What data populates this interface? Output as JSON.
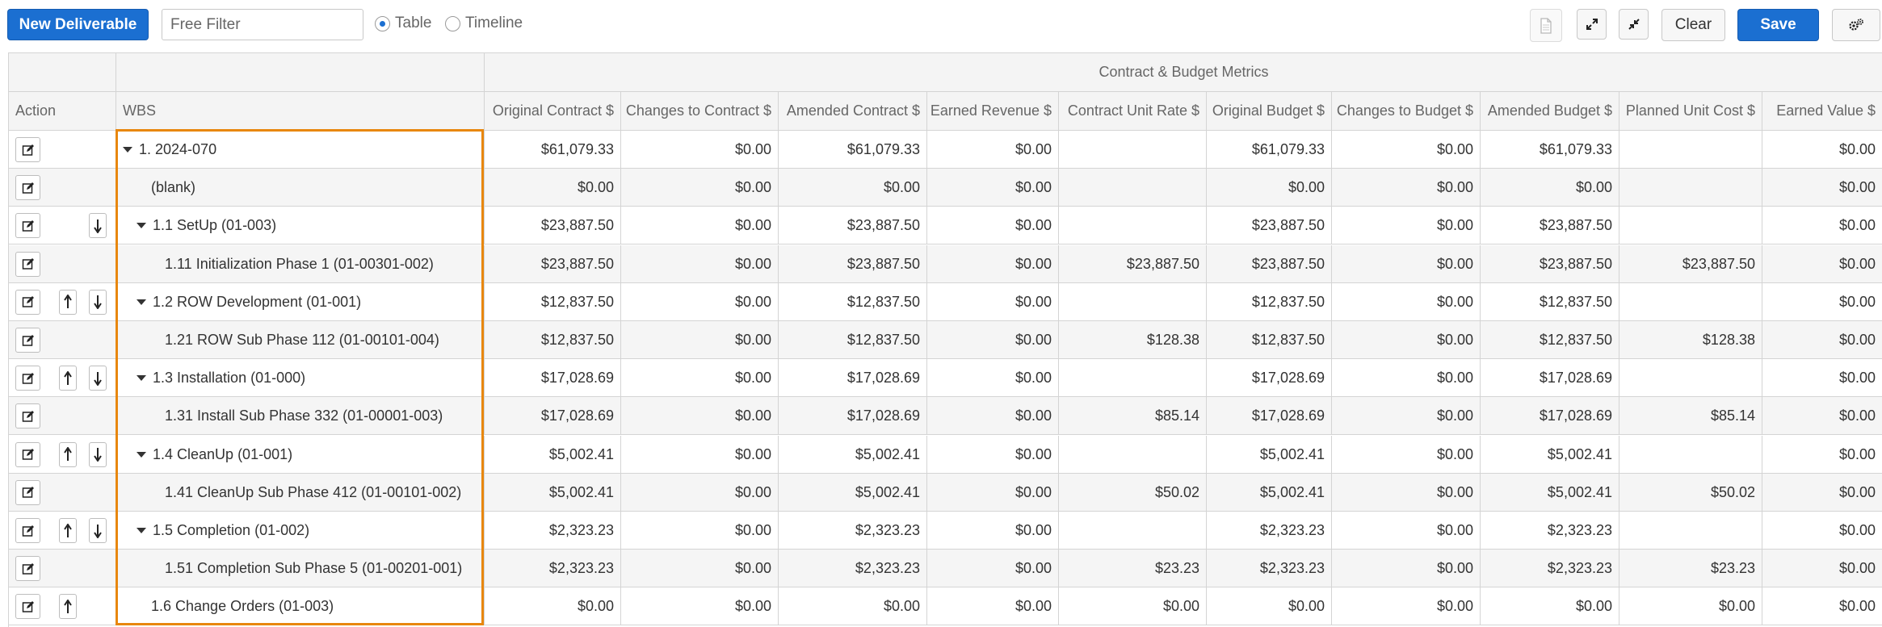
{
  "toolbar": {
    "new_deliverable": "New Deliverable",
    "filter_placeholder": "Free Filter",
    "view_table": "Table",
    "view_timeline": "Timeline",
    "selected_view": "Table",
    "clear": "Clear",
    "save": "Save",
    "icons": [
      "document-icon",
      "expand-icon",
      "collapse-icon",
      "settings-icon"
    ]
  },
  "group_header": "Contract & Budget Metrics",
  "columns": {
    "action": "Action",
    "wbs": "WBS",
    "original_contract": "Original Contract $",
    "changes_to_contract": "Changes to Contract $",
    "amended_contract": "Amended Contract $",
    "earned_revenue": "Earned Revenue $",
    "contract_unit_rate": "Contract Unit Rate $",
    "original_budget": "Original Budget $",
    "changes_to_budget": "Changes to Budget $",
    "amended_budget": "Amended Budget $",
    "planned_unit_cost": "Planned Unit Cost $",
    "earned_value": "Earned Value $"
  },
  "rows": [
    {
      "wbs": "1. 2024-070",
      "level": 0,
      "expandable": true,
      "up": false,
      "down": false,
      "v": [
        "$61,079.33",
        "$0.00",
        "$61,079.33",
        "$0.00",
        "",
        "$61,079.33",
        "$0.00",
        "$61,079.33",
        "",
        "$0.00"
      ]
    },
    {
      "wbs": "(blank)",
      "level": 1,
      "expandable": false,
      "up": false,
      "down": false,
      "v": [
        "$0.00",
        "$0.00",
        "$0.00",
        "$0.00",
        "",
        "$0.00",
        "$0.00",
        "$0.00",
        "",
        "$0.00"
      ]
    },
    {
      "wbs": "1.1 SetUp (01-003)",
      "level": 1,
      "expandable": true,
      "up": false,
      "down": true,
      "v": [
        "$23,887.50",
        "$0.00",
        "$23,887.50",
        "$0.00",
        "",
        "$23,887.50",
        "$0.00",
        "$23,887.50",
        "",
        "$0.00"
      ]
    },
    {
      "wbs": "1.11 Initialization Phase 1 (01-00301-002)",
      "level": 2,
      "expandable": false,
      "up": false,
      "down": false,
      "v": [
        "$23,887.50",
        "$0.00",
        "$23,887.50",
        "$0.00",
        "$23,887.50",
        "$23,887.50",
        "$0.00",
        "$23,887.50",
        "$23,887.50",
        "$0.00"
      ]
    },
    {
      "wbs": "1.2 ROW Development (01-001)",
      "level": 1,
      "expandable": true,
      "up": true,
      "down": true,
      "v": [
        "$12,837.50",
        "$0.00",
        "$12,837.50",
        "$0.00",
        "",
        "$12,837.50",
        "$0.00",
        "$12,837.50",
        "",
        "$0.00"
      ]
    },
    {
      "wbs": "1.21 ROW Sub Phase 112 (01-00101-004)",
      "level": 2,
      "expandable": false,
      "up": false,
      "down": false,
      "v": [
        "$12,837.50",
        "$0.00",
        "$12,837.50",
        "$0.00",
        "$128.38",
        "$12,837.50",
        "$0.00",
        "$12,837.50",
        "$128.38",
        "$0.00"
      ]
    },
    {
      "wbs": "1.3 Installation (01-000)",
      "level": 1,
      "expandable": true,
      "up": true,
      "down": true,
      "v": [
        "$17,028.69",
        "$0.00",
        "$17,028.69",
        "$0.00",
        "",
        "$17,028.69",
        "$0.00",
        "$17,028.69",
        "",
        "$0.00"
      ]
    },
    {
      "wbs": "1.31 Install Sub Phase 332 (01-00001-003)",
      "level": 2,
      "expandable": false,
      "up": false,
      "down": false,
      "v": [
        "$17,028.69",
        "$0.00",
        "$17,028.69",
        "$0.00",
        "$85.14",
        "$17,028.69",
        "$0.00",
        "$17,028.69",
        "$85.14",
        "$0.00"
      ]
    },
    {
      "wbs": "1.4 CleanUp (01-001)",
      "level": 1,
      "expandable": true,
      "up": true,
      "down": true,
      "v": [
        "$5,002.41",
        "$0.00",
        "$5,002.41",
        "$0.00",
        "",
        "$5,002.41",
        "$0.00",
        "$5,002.41",
        "",
        "$0.00"
      ]
    },
    {
      "wbs": "1.41 CleanUp Sub Phase 412 (01-00101-002)",
      "level": 2,
      "expandable": false,
      "up": false,
      "down": false,
      "v": [
        "$5,002.41",
        "$0.00",
        "$5,002.41",
        "$0.00",
        "$50.02",
        "$5,002.41",
        "$0.00",
        "$5,002.41",
        "$50.02",
        "$0.00"
      ]
    },
    {
      "wbs": "1.5 Completion (01-002)",
      "level": 1,
      "expandable": true,
      "up": true,
      "down": true,
      "v": [
        "$2,323.23",
        "$0.00",
        "$2,323.23",
        "$0.00",
        "",
        "$2,323.23",
        "$0.00",
        "$2,323.23",
        "",
        "$0.00"
      ]
    },
    {
      "wbs": "1.51 Completion Sub Phase 5 (01-00201-001)",
      "level": 2,
      "expandable": false,
      "up": false,
      "down": false,
      "v": [
        "$2,323.23",
        "$0.00",
        "$2,323.23",
        "$0.00",
        "$23.23",
        "$2,323.23",
        "$0.00",
        "$2,323.23",
        "$23.23",
        "$0.00"
      ]
    },
    {
      "wbs": "1.6 Change Orders (01-003)",
      "level": 1,
      "expandable": false,
      "up": true,
      "down": false,
      "v": [
        "$0.00",
        "$0.00",
        "$0.00",
        "$0.00",
        "$0.00",
        "$0.00",
        "$0.00",
        "$0.00",
        "$0.00",
        "$0.00"
      ]
    }
  ],
  "colors": {
    "primary": "#1b6fd1",
    "highlight": "#e8870e",
    "header_bg": "#f4f4f4",
    "alt_row_bg": "#f5f5f5"
  }
}
